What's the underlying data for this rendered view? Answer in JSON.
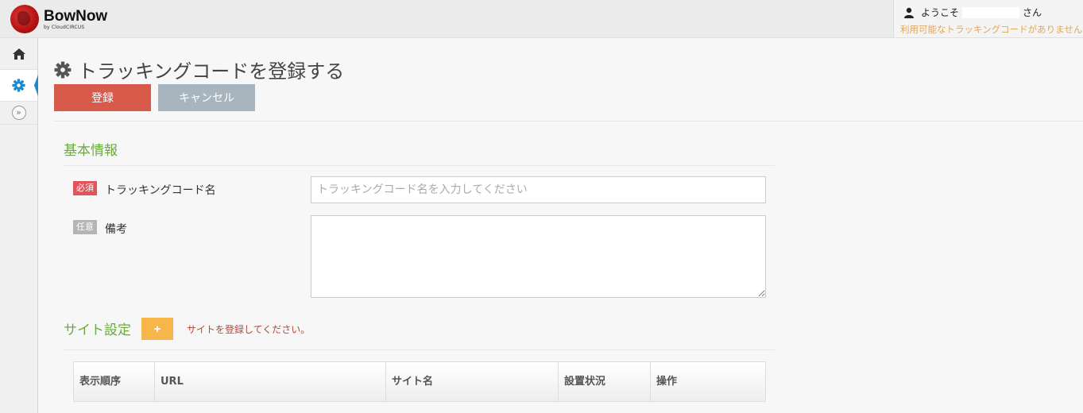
{
  "header": {
    "logo_name": "BowNow",
    "logo_sub": "by CloudCIRCUS",
    "welcome_prefix": "ようこそ",
    "welcome_suffix": "さん",
    "notice": "利用可能なトラッキングコードがありません"
  },
  "sidebar": {
    "items": [
      {
        "icon": "home-icon"
      },
      {
        "icon": "gear-icon",
        "active": true
      }
    ],
    "expand_label": "»"
  },
  "page": {
    "title": "トラッキングコードを登録する",
    "register_label": "登録",
    "cancel_label": "キャンセル"
  },
  "basic_info": {
    "section_title": "基本情報",
    "name_badge": "必須",
    "name_label": "トラッキングコード名",
    "name_placeholder": "トラッキングコード名を入力してください",
    "name_value": "",
    "note_badge": "任意",
    "note_label": "備考",
    "note_value": ""
  },
  "site_settings": {
    "section_title": "サイト設定",
    "add_label": "+",
    "hint": "サイトを登録してください。",
    "columns": [
      "表示順序",
      "URL",
      "サイト名",
      "設置状況",
      "操作"
    ]
  },
  "colors": {
    "accent_green": "#6aab3e",
    "register_red": "#d75a4a",
    "cancel_gray": "#a8b5bf",
    "add_orange": "#f6b64a",
    "required_badge": "#e0545a",
    "notice_orange": "#e0a85c",
    "active_blue": "#1e88c9"
  }
}
